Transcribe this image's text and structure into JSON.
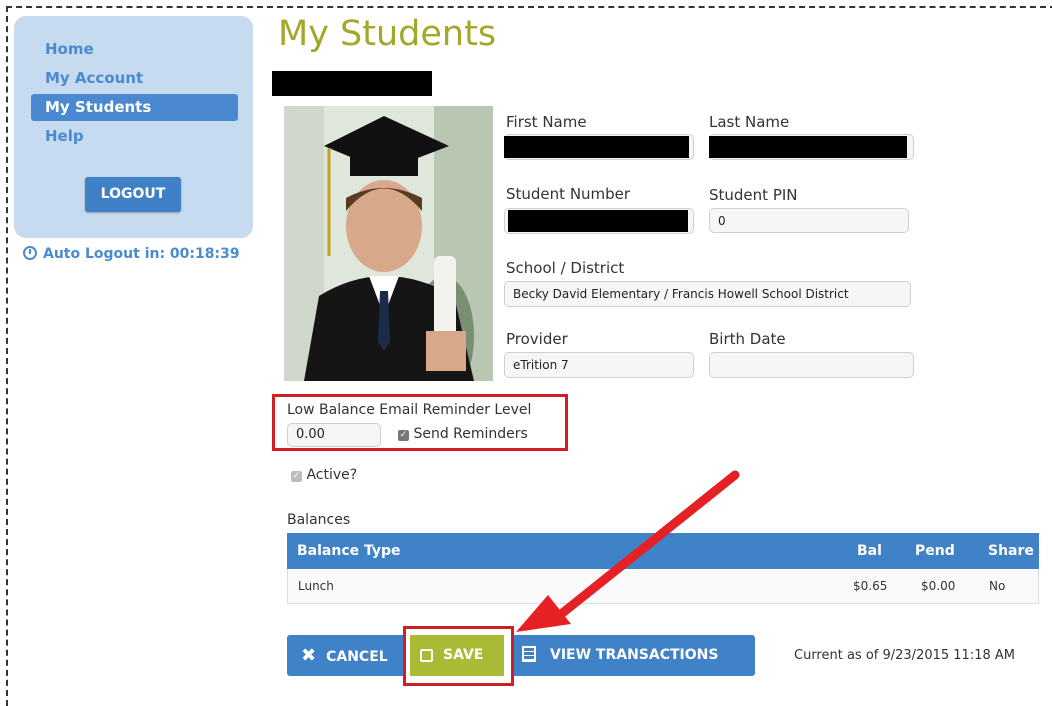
{
  "nav": {
    "items": [
      {
        "label": "Home",
        "active": false
      },
      {
        "label": "My Account",
        "active": false
      },
      {
        "label": "My Students",
        "active": true
      },
      {
        "label": "Help",
        "active": false
      }
    ],
    "logout_label": "LOGOUT",
    "auto_logout": "Auto Logout in: 00:18:39"
  },
  "page": {
    "title": "My Students"
  },
  "student": {
    "first_name_label": "First Name",
    "last_name_label": "Last Name",
    "student_number_label": "Student Number",
    "student_pin_label": "Student PIN",
    "student_pin_value": "0",
    "school_label": "School / District",
    "school_value": "Becky David Elementary / Francis Howell School District",
    "provider_label": "Provider",
    "provider_value": "eTrition 7",
    "birth_date_label": "Birth Date",
    "birth_date_value": ""
  },
  "reminder": {
    "label": "Low Balance Email Reminder Level",
    "value": "0.00",
    "send_label": "Send Reminders",
    "send_checked": true
  },
  "active": {
    "label": "Active?",
    "checked": true
  },
  "balances": {
    "title": "Balances",
    "columns": [
      "Balance Type",
      "Bal",
      "Pend",
      "Share"
    ],
    "rows": [
      [
        "Lunch",
        "$0.65",
        "$0.00",
        "No"
      ]
    ]
  },
  "actions": {
    "cancel_label": "CANCEL",
    "save_label": "SAVE",
    "view_label": "VIEW TRANSACTIONS"
  },
  "status": {
    "current_as_of": "Current as of 9/23/2015 11:18 AM"
  },
  "colors": {
    "accent_blue": "#3f82c7",
    "save_green": "#a9ba34",
    "title_olive": "#a3a82a",
    "highlight_red": "#cf1f25"
  }
}
